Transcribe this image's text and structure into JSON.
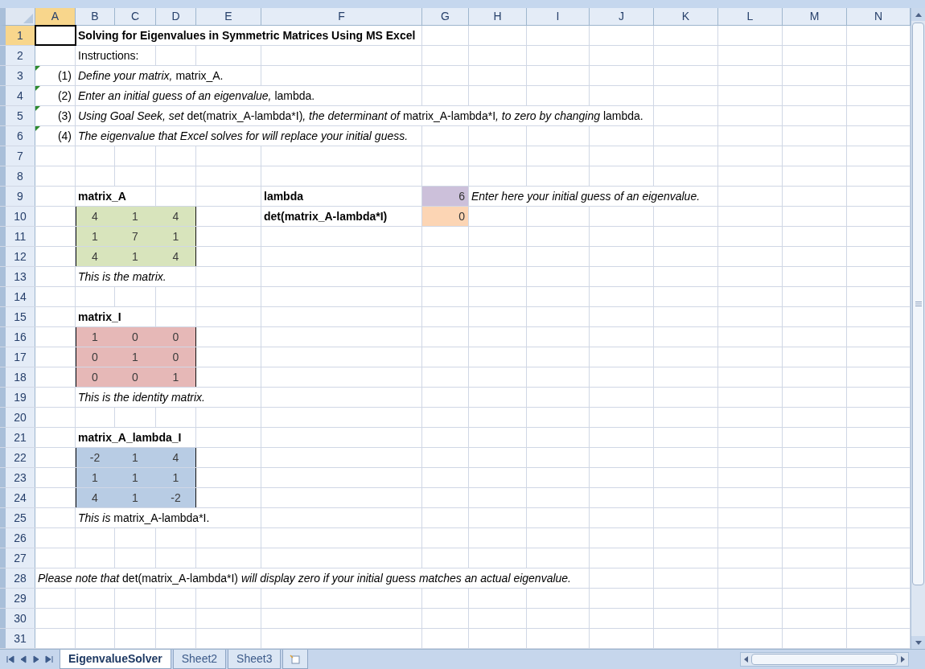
{
  "column_headers": [
    {
      "label": "A",
      "selected": true
    },
    {
      "label": "B",
      "selected": false
    },
    {
      "label": "C",
      "selected": false
    },
    {
      "label": "D",
      "selected": false
    },
    {
      "label": "E",
      "selected": false
    },
    {
      "label": "F",
      "selected": false
    },
    {
      "label": "G",
      "selected": false
    },
    {
      "label": "H",
      "selected": false
    },
    {
      "label": "I",
      "selected": false
    },
    {
      "label": "J",
      "selected": false
    },
    {
      "label": "K",
      "selected": false
    },
    {
      "label": "L",
      "selected": false
    },
    {
      "label": "M",
      "selected": false
    },
    {
      "label": "N",
      "selected": false
    }
  ],
  "rows": [
    {
      "number": "1",
      "selected": true,
      "cells": [
        {
          "kind": "empty",
          "selected": true
        },
        {
          "kind": "heading",
          "selected": false,
          "text": "Solving for Eigenvalues in Symmetric Matrices Using MS Excel"
        }
      ]
    },
    {
      "number": "2",
      "selected": false,
      "cells": [
        {
          "kind": "empty",
          "selected": false
        },
        {
          "kind": "text",
          "selected": false,
          "runs": [
            {
              "text": "Instructions:",
              "italic": false
            }
          ]
        }
      ]
    },
    {
      "number": "3",
      "selected": false,
      "cells": [
        {
          "kind": "label",
          "selected": false,
          "flag": true,
          "text": "(1)"
        },
        {
          "kind": "text",
          "selected": false,
          "runs": [
            {
              "text": "Define your matrix, ",
              "italic": true
            },
            {
              "text": "matrix_A.",
              "italic": false
            }
          ]
        }
      ]
    },
    {
      "number": "4",
      "selected": false,
      "cells": [
        {
          "kind": "label",
          "selected": false,
          "flag": true,
          "text": "(2)"
        },
        {
          "kind": "text",
          "selected": false,
          "runs": [
            {
              "text": "Enter an initial guess of an eigenvalue, ",
              "italic": true
            },
            {
              "text": "lambda.",
              "italic": false
            }
          ]
        }
      ]
    },
    {
      "number": "5",
      "selected": false,
      "cells": [
        {
          "kind": "label",
          "selected": false,
          "flag": true,
          "text": "(3)"
        },
        {
          "kind": "text",
          "selected": false,
          "runs": [
            {
              "text": "Using Goal Seek, set ",
              "italic": true
            },
            {
              "text": "det(matrix_A-lambda*I)",
              "italic": false
            },
            {
              "text": ", the determinant of ",
              "italic": true
            },
            {
              "text": "matrix_A-lambda*I",
              "italic": false
            },
            {
              "text": ", to zero by changing ",
              "italic": true
            },
            {
              "text": "lambda.",
              "italic": false
            }
          ]
        }
      ]
    },
    {
      "number": "6",
      "selected": false,
      "cells": [
        {
          "kind": "label",
          "selected": false,
          "flag": true,
          "text": "(4)"
        },
        {
          "kind": "text",
          "selected": false,
          "runs": [
            {
              "text": "The eigenvalue that Excel solves for will replace your initial guess.",
              "italic": true
            }
          ]
        }
      ]
    },
    {
      "number": "7",
      "selected": false,
      "cells": []
    },
    {
      "number": "8",
      "selected": false,
      "cells": []
    },
    {
      "number": "9",
      "selected": false,
      "cells": [
        {
          "kind": "empty",
          "selected": false
        },
        {
          "kind": "heading",
          "selected": false,
          "text": "matrix_A"
        },
        {
          "kind": "empty",
          "selected": false
        },
        {
          "kind": "empty",
          "selected": false
        },
        {
          "kind": "empty",
          "selected": false
        },
        {
          "kind": "heading",
          "selected": false,
          "text": "lambda"
        },
        {
          "kind": "value",
          "selected": false,
          "text": "6",
          "color": "#ccc0da"
        },
        {
          "kind": "text",
          "selected": false,
          "runs": [
            {
              "text": "Enter here your initial guess of an eigenvalue.",
              "italic": true
            }
          ]
        }
      ]
    },
    {
      "number": "10",
      "selected": false,
      "cells": [
        {
          "kind": "empty",
          "selected": false
        },
        {
          "kind": "matrix",
          "selected": false,
          "text": "4",
          "color": "#d8e4bc"
        },
        {
          "kind": "matrix",
          "selected": false,
          "text": "1",
          "color": "#d8e4bc"
        },
        {
          "kind": "matrix",
          "selected": false,
          "text": "4",
          "color": "#d8e4bc"
        },
        {
          "kind": "empty",
          "selected": false
        },
        {
          "kind": "heading",
          "selected": false,
          "text": "det(matrix_A-lambda*I)"
        },
        {
          "kind": "value",
          "selected": false,
          "text": "0",
          "color": "#fcd5b4"
        }
      ]
    },
    {
      "number": "11",
      "selected": false,
      "cells": [
        {
          "kind": "empty",
          "selected": false
        },
        {
          "kind": "matrix",
          "selected": false,
          "text": "1",
          "color": "#d8e4bc"
        },
        {
          "kind": "matrix",
          "selected": false,
          "text": "7",
          "color": "#d8e4bc"
        },
        {
          "kind": "matrix",
          "selected": false,
          "text": "1",
          "color": "#d8e4bc"
        }
      ]
    },
    {
      "number": "12",
      "selected": false,
      "cells": [
        {
          "kind": "empty",
          "selected": false
        },
        {
          "kind": "matrix",
          "selected": false,
          "text": "4",
          "color": "#d8e4bc"
        },
        {
          "kind": "matrix",
          "selected": false,
          "text": "1",
          "color": "#d8e4bc"
        },
        {
          "kind": "matrix",
          "selected": false,
          "text": "4",
          "color": "#d8e4bc"
        }
      ]
    },
    {
      "number": "13",
      "selected": false,
      "cells": [
        {
          "kind": "empty",
          "selected": false
        },
        {
          "kind": "text",
          "selected": false,
          "runs": [
            {
              "text": "This is the matrix.",
              "italic": true
            }
          ]
        }
      ]
    },
    {
      "number": "14",
      "selected": false,
      "cells": []
    },
    {
      "number": "15",
      "selected": false,
      "cells": [
        {
          "kind": "empty",
          "selected": false
        },
        {
          "kind": "heading",
          "selected": false,
          "text": "matrix_I"
        }
      ]
    },
    {
      "number": "16",
      "selected": false,
      "cells": [
        {
          "kind": "empty",
          "selected": false
        },
        {
          "kind": "matrix",
          "selected": false,
          "text": "1",
          "color": "#e6b8b7"
        },
        {
          "kind": "matrix",
          "selected": false,
          "text": "0",
          "color": "#e6b8b7"
        },
        {
          "kind": "matrix",
          "selected": false,
          "text": "0",
          "color": "#e6b8b7"
        }
      ]
    },
    {
      "number": "17",
      "selected": false,
      "cells": [
        {
          "kind": "empty",
          "selected": false
        },
        {
          "kind": "matrix",
          "selected": false,
          "text": "0",
          "color": "#e6b8b7"
        },
        {
          "kind": "matrix",
          "selected": false,
          "text": "1",
          "color": "#e6b8b7"
        },
        {
          "kind": "matrix",
          "selected": false,
          "text": "0",
          "color": "#e6b8b7"
        }
      ]
    },
    {
      "number": "18",
      "selected": false,
      "cells": [
        {
          "kind": "empty",
          "selected": false
        },
        {
          "kind": "matrix",
          "selected": false,
          "text": "0",
          "color": "#e6b8b7"
        },
        {
          "kind": "matrix",
          "selected": false,
          "text": "0",
          "color": "#e6b8b7"
        },
        {
          "kind": "matrix",
          "selected": false,
          "text": "1",
          "color": "#e6b8b7"
        }
      ]
    },
    {
      "number": "19",
      "selected": false,
      "cells": [
        {
          "kind": "empty",
          "selected": false
        },
        {
          "kind": "text",
          "selected": false,
          "runs": [
            {
              "text": "This is the identity matrix.",
              "italic": true
            }
          ]
        }
      ]
    },
    {
      "number": "20",
      "selected": false,
      "cells": []
    },
    {
      "number": "21",
      "selected": false,
      "cells": [
        {
          "kind": "empty",
          "selected": false
        },
        {
          "kind": "heading",
          "selected": false,
          "text": "matrix_A_lambda_I"
        }
      ]
    },
    {
      "number": "22",
      "selected": false,
      "cells": [
        {
          "kind": "empty",
          "selected": false
        },
        {
          "kind": "matrix",
          "selected": false,
          "text": "-2",
          "color": "#b8cce4"
        },
        {
          "kind": "matrix",
          "selected": false,
          "text": "1",
          "color": "#b8cce4"
        },
        {
          "kind": "matrix",
          "selected": false,
          "text": "4",
          "color": "#b8cce4"
        }
      ]
    },
    {
      "number": "23",
      "selected": false,
      "cells": [
        {
          "kind": "empty",
          "selected": false
        },
        {
          "kind": "matrix",
          "selected": false,
          "text": "1",
          "color": "#b8cce4"
        },
        {
          "kind": "matrix",
          "selected": false,
          "text": "1",
          "color": "#b8cce4"
        },
        {
          "kind": "matrix",
          "selected": false,
          "text": "1",
          "color": "#b8cce4"
        }
      ]
    },
    {
      "number": "24",
      "selected": false,
      "cells": [
        {
          "kind": "empty",
          "selected": false
        },
        {
          "kind": "matrix",
          "selected": false,
          "text": "4",
          "color": "#b8cce4"
        },
        {
          "kind": "matrix",
          "selected": false,
          "text": "1",
          "color": "#b8cce4"
        },
        {
          "kind": "matrix",
          "selected": false,
          "text": "-2",
          "color": "#b8cce4"
        }
      ]
    },
    {
      "number": "25",
      "selected": false,
      "cells": [
        {
          "kind": "empty",
          "selected": false
        },
        {
          "kind": "text",
          "selected": false,
          "runs": [
            {
              "text": "This is ",
              "italic": true
            },
            {
              "text": "matrix_A-lambda*I.",
              "italic": false
            }
          ]
        }
      ]
    },
    {
      "number": "26",
      "selected": false,
      "cells": []
    },
    {
      "number": "27",
      "selected": false,
      "cells": []
    },
    {
      "number": "28",
      "selected": false,
      "cells": [
        {
          "kind": "text",
          "selected": false,
          "runs": [
            {
              "text": "Please note that ",
              "italic": true
            },
            {
              "text": "det(matrix_A-lambda*I)",
              "italic": false
            },
            {
              "text": " will display zero if your initial guess matches an actual eigenvalue.",
              "italic": true
            }
          ]
        }
      ]
    },
    {
      "number": "29",
      "selected": false,
      "cells": []
    },
    {
      "number": "30",
      "selected": false,
      "cells": []
    },
    {
      "number": "31",
      "selected": false,
      "cells": []
    }
  ],
  "sheet_tabs": [
    {
      "label": "EigenvalueSolver",
      "selected": true
    },
    {
      "label": "Sheet2",
      "selected": false
    },
    {
      "label": "Sheet3",
      "selected": false
    }
  ]
}
